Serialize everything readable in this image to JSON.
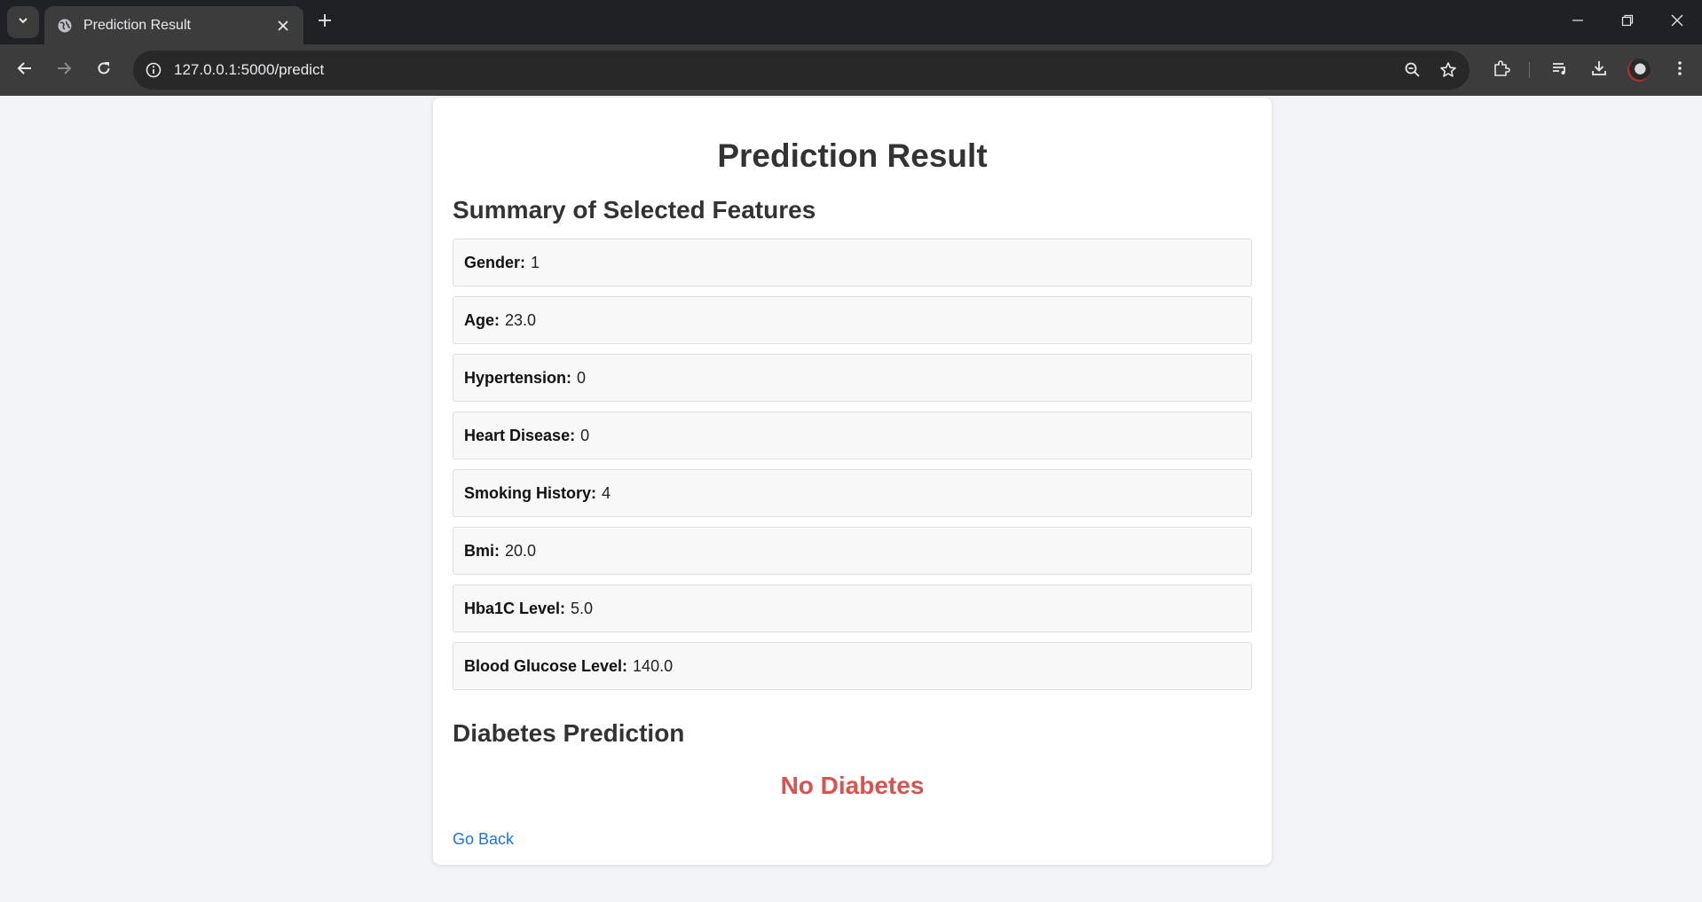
{
  "browser": {
    "tab_title": "Prediction Result",
    "url": "127.0.0.1:5000/predict"
  },
  "page": {
    "title": "Prediction Result",
    "summary_heading": "Summary of Selected Features",
    "features": [
      {
        "label": "Gender:",
        "value": "1"
      },
      {
        "label": "Age:",
        "value": "23.0"
      },
      {
        "label": "Hypertension:",
        "value": "0"
      },
      {
        "label": "Heart Disease:",
        "value": "0"
      },
      {
        "label": "Smoking History:",
        "value": "4"
      },
      {
        "label": "Bmi:",
        "value": "20.0"
      },
      {
        "label": "Hba1C Level:",
        "value": "5.0"
      },
      {
        "label": "Blood Glucose Level:",
        "value": "140.0"
      }
    ],
    "prediction_heading": "Diabetes Prediction",
    "prediction_result": "No Diabetes",
    "go_back_label": "Go Back"
  },
  "colors": {
    "result_color": "#d9534f",
    "link_color": "#1a73e8",
    "page_background": "#f3f4f8"
  }
}
